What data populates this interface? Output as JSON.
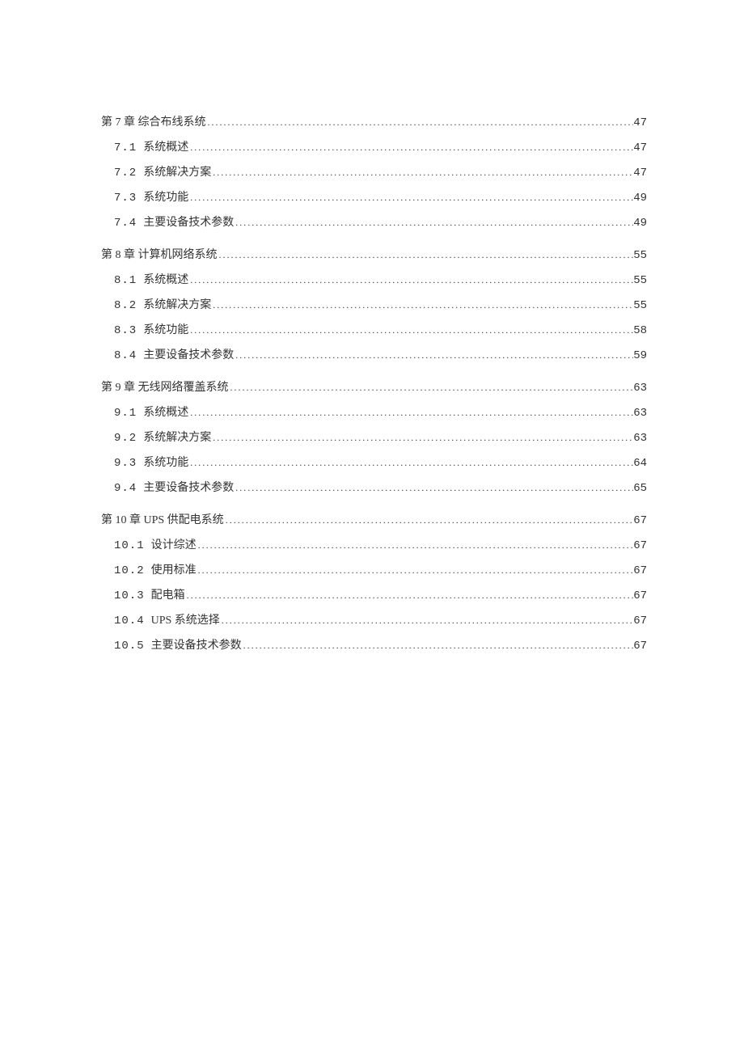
{
  "toc": [
    {
      "type": "chapter",
      "title": "第 7 章 综合布线系统",
      "page": "47"
    },
    {
      "type": "sub",
      "num": "7.1",
      "title": "系统概述",
      "page": "47"
    },
    {
      "type": "sub",
      "num": "7.2",
      "title": "系统解决方案",
      "page": "47"
    },
    {
      "type": "sub",
      "num": "7.3",
      "title": "系统功能",
      "page": "49"
    },
    {
      "type": "sub",
      "num": "7.4",
      "title": "主要设备技术参数",
      "page": "49"
    },
    {
      "type": "chapter",
      "title": "第 8 章 计算机网络系统",
      "page": "55"
    },
    {
      "type": "sub",
      "num": "8.1",
      "title": "系统概述",
      "page": "55"
    },
    {
      "type": "sub",
      "num": "8.2",
      "title": "系统解决方案",
      "page": "55"
    },
    {
      "type": "sub",
      "num": "8.3",
      "title": "系统功能",
      "page": "58"
    },
    {
      "type": "sub",
      "num": "8.4",
      "title": "主要设备技术参数",
      "page": "59"
    },
    {
      "type": "chapter",
      "title": "第 9 章 无线网络覆盖系统",
      "page": "63"
    },
    {
      "type": "sub",
      "num": "9.1",
      "title": "系统概述",
      "page": "63"
    },
    {
      "type": "sub",
      "num": "9.2",
      "title": "系统解决方案",
      "page": "63"
    },
    {
      "type": "sub",
      "num": "9.3",
      "title": "系统功能",
      "page": "64"
    },
    {
      "type": "sub",
      "num": "9.4",
      "title": "主要设备技术参数",
      "page": "65"
    },
    {
      "type": "chapter",
      "title": "第 10 章 UPS 供配电系统",
      "page": "67"
    },
    {
      "type": "sub",
      "num": "10.1",
      "title": "设计综述",
      "page": "67"
    },
    {
      "type": "sub",
      "num": "10.2",
      "title": "使用标准",
      "page": "67"
    },
    {
      "type": "sub",
      "num": "10.3",
      "title": "配电箱",
      "page": "67"
    },
    {
      "type": "sub",
      "num": "10.4",
      "title": "UPS 系统选择",
      "page": "67"
    },
    {
      "type": "sub",
      "num": "10.5",
      "title": "主要设备技术参数",
      "page": "67"
    }
  ]
}
